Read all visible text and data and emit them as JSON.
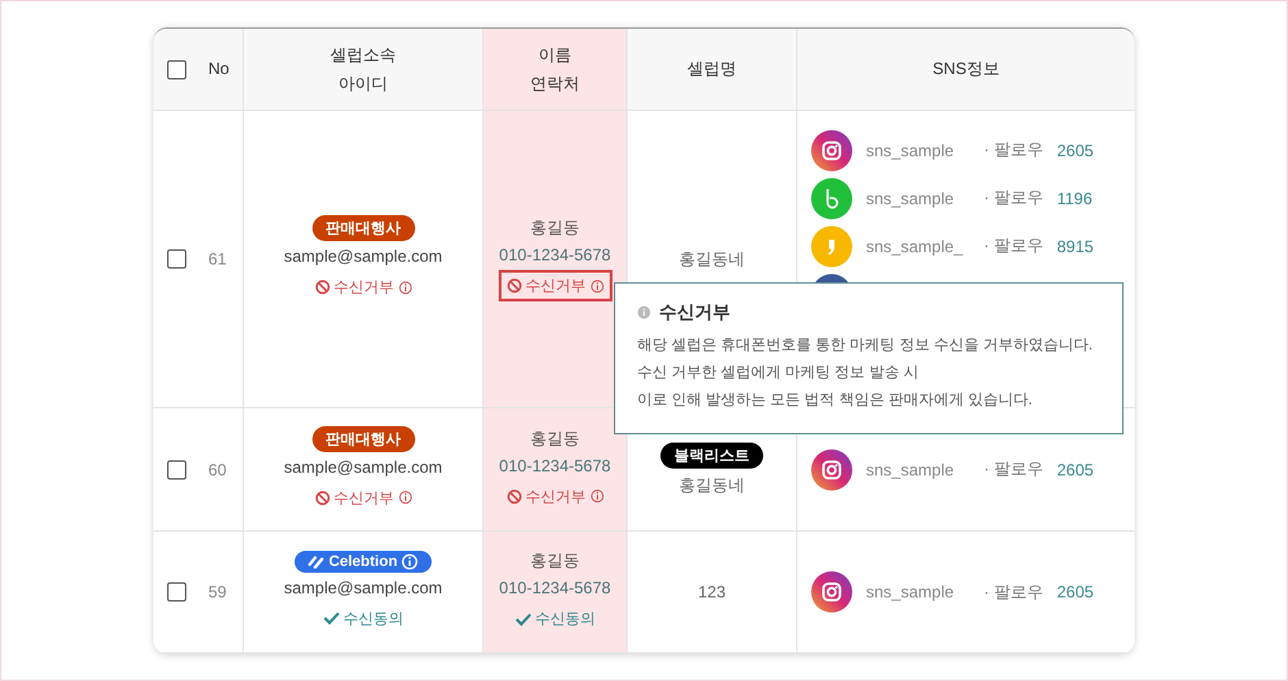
{
  "header": {
    "select_all": {
      "checked": false
    },
    "columns": [
      {
        "lines": [
          "No"
        ],
        "highlighted": false
      },
      {
        "lines": [
          "셀럽소속",
          "아이디"
        ],
        "highlighted": false
      },
      {
        "lines": [
          "이름",
          "연락처"
        ],
        "highlighted": true
      },
      {
        "lines": [
          "셀럽명"
        ],
        "highlighted": false
      },
      {
        "lines": [
          "SNS정보"
        ],
        "highlighted": false
      }
    ]
  },
  "rows": [
    {
      "checked": false,
      "no": "61",
      "agency": {
        "kind": "seller",
        "label": "판매대행사"
      },
      "email": "sample@sample.com",
      "consent": {
        "kind": "refuse",
        "label": "수신거부"
      },
      "name": "홍길동",
      "phone": "010-1234-5678",
      "contact_consent": {
        "kind": "refuse",
        "label": "수신거부",
        "focused": true
      },
      "celeb_name": "홍길동네",
      "sns": [
        {
          "kind": "instagram",
          "handle": "sns_sample",
          "follow": "· 팔로우",
          "count": "2605"
        },
        {
          "kind": "band",
          "handle": "sns_sample",
          "follow": "· 팔로우",
          "count": "1196"
        },
        {
          "kind": "kakao",
          "handle": "sns_sample_",
          "follow": "· 팔로우",
          "count": "8915"
        },
        {
          "kind": "facebook"
        }
      ]
    },
    {
      "checked": false,
      "no": "60",
      "agency": {
        "kind": "seller",
        "label": "판매대행사"
      },
      "email": "sample@sample.com",
      "consent": {
        "kind": "refuse",
        "label": "수신거부"
      },
      "name": "홍길동",
      "phone": "010-1234-5678",
      "contact_consent": {
        "kind": "refuse",
        "label": "수신거부",
        "focused": false
      },
      "blacklist": "블랙리스트",
      "celeb_name": "홍길동네",
      "sns": [
        {
          "kind": "instagram",
          "handle": "sns_sample",
          "follow": "· 팔로우",
          "count": "2605"
        }
      ]
    },
    {
      "checked": false,
      "no": "59",
      "agency": {
        "kind": "celebtion",
        "label": "Celebtion"
      },
      "email": "sample@sample.com",
      "consent": {
        "kind": "agree",
        "label": "수신동의"
      },
      "name": "홍길동",
      "phone": "010-1234-5678",
      "contact_consent": {
        "kind": "agree",
        "label": "수신동의",
        "focused": false
      },
      "celeb_name": "123",
      "sns": [
        {
          "kind": "instagram",
          "handle": "sns_sample",
          "follow": "· 팔로우",
          "count": "2605"
        }
      ]
    }
  ],
  "tooltip": {
    "title": "수신거부",
    "lines": [
      "해당 셀럽은 휴대폰번호를 통한 마케팅 정보 수신을 거부하였습니다.",
      "수신 거부한 셀럽에게 마케팅 정보 발송 시",
      "이로 인해 발생하는 모든 법적 책임은 판매자에게 있습니다."
    ]
  }
}
